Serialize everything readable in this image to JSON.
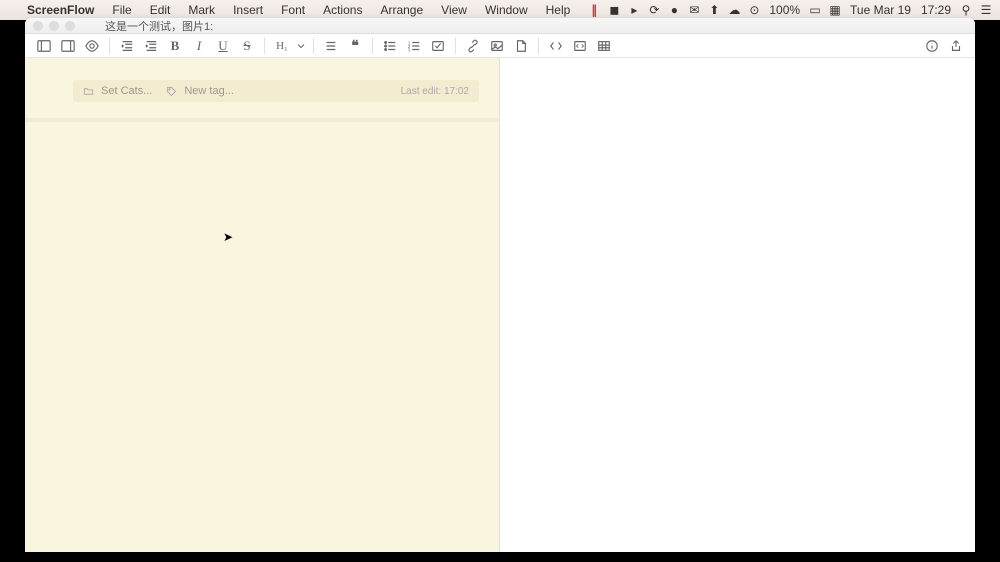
{
  "menubar": {
    "app_name": "ScreenFlow",
    "items": [
      "File",
      "Edit",
      "Mark",
      "Insert",
      "Font",
      "Actions",
      "Arrange",
      "View",
      "Window",
      "Help"
    ],
    "battery": "100%",
    "date": "Tue Mar 19",
    "time": "17:29"
  },
  "titlebar": {
    "tab_title": "这是一个测试，图片1:"
  },
  "toolbar": {
    "bold": "B",
    "italic": "I",
    "underline": "U",
    "strike": "S",
    "heading": "H₁",
    "quote": "❝"
  },
  "meta": {
    "set_cats": "Set Cats...",
    "new_tag": "New tag...",
    "last_edit": "Last edit: 17:02"
  }
}
